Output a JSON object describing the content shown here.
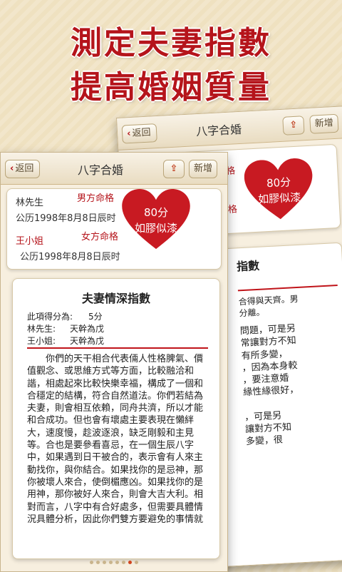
{
  "headline": {
    "line1": "測定夫妻指數",
    "line2": "提高婚姻質量"
  },
  "app": {
    "back_label": "返回",
    "title": "八字合婚",
    "new_label": "新增",
    "share_icon": "share-icon"
  },
  "husband": {
    "name": "林先生",
    "role": "男方命格",
    "birth": "公历1998年8月8日辰时"
  },
  "wife": {
    "name": "王小姐",
    "role": "女方命格",
    "birth": "公历1998年8月8日辰时"
  },
  "score": {
    "value": "80分",
    "verdict": "如膠似漆",
    "heart_color": "#c81a22"
  },
  "back_card": {
    "role_fragment_1": "格",
    "role_fragment_2": "格",
    "title_fragment": "指數",
    "stat_fragment_1": "合得與天齊。男",
    "stat_fragment_2": "分離。",
    "para_lines": [
      "問題，可是另",
      "常讓對方不知",
      "有所多變，",
      "，因為本身較",
      "，要注意婚",
      "緣性緣很好，",
      "",
      "，可是另",
      "讓對方不知",
      "多變，很"
    ]
  },
  "report": {
    "title": "夫妻情深指數",
    "score_label": "此項得分為:",
    "score_value": "5分",
    "husband_label": "林先生:",
    "husband_value": "天幹為戊",
    "wife_label": "王小姐:",
    "wife_value": "天幹為戊",
    "paragraph": "你們的天干相合代表倆人性格脾氣、價值觀念、或思維方式等方面，比較融洽和諧，相處起來比較快樂幸福，構成了一個和合穩定的結構，符合自然道法。你們若結為夫妻，則會相互依賴，同舟共濟，所以才能和合成功。但也會有壞處主要表現在懶絆大，速度慢，趁波逐浪，缺乏剛毅和主見等。合也是要參看喜忌，在一個生辰八字中，如果遇到日干被合的，表示會有人來主動找你，與你結合。如果找你的是忌神，那你被壞人來合，使倒楣應凶。如果找你的是用神，那你被好人來合，則會大吉大利。相對而言，八字中有合好處多，但需要具體情況具體分析，因此你們雙方要避免的事情就"
  },
  "pagination": {
    "count": 8,
    "active_index": 6
  }
}
